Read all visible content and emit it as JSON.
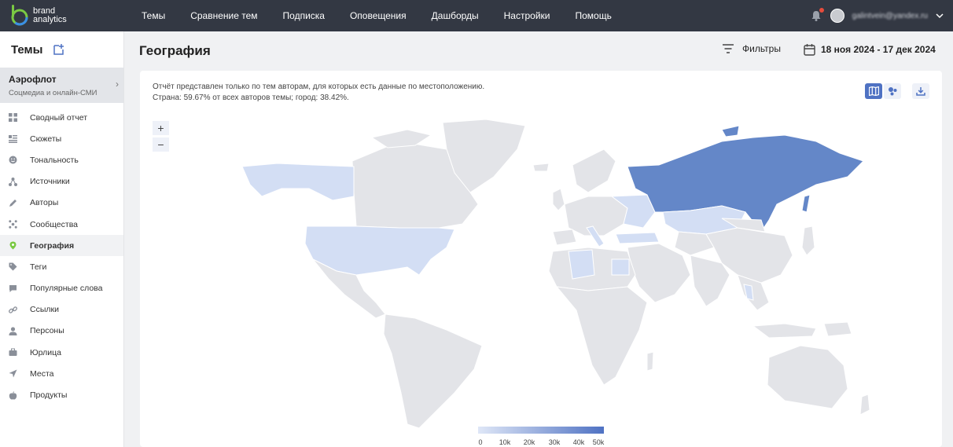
{
  "brand": {
    "line1": "brand",
    "line2": "analytics"
  },
  "nav": {
    "items": [
      "Темы",
      "Сравнение тем",
      "Подписка",
      "Оповещения",
      "Дашборды",
      "Настройки",
      "Помощь"
    ],
    "user_email": "galintvein@yandex.ru"
  },
  "sidebar": {
    "title": "Темы",
    "topic": {
      "name": "Аэрофлот",
      "subtitle": "Соцмедиа и онлайн-СМИ"
    },
    "items": [
      {
        "label": "Сводный отчет",
        "icon": "grid-icon"
      },
      {
        "label": "Сюжеты",
        "icon": "list-icon"
      },
      {
        "label": "Тональность",
        "icon": "smile-icon"
      },
      {
        "label": "Источники",
        "icon": "nodes-icon"
      },
      {
        "label": "Авторы",
        "icon": "pen-icon"
      },
      {
        "label": "Сообщества",
        "icon": "community-icon"
      },
      {
        "label": "География",
        "icon": "location-pin-icon",
        "active": true
      },
      {
        "label": "Теги",
        "icon": "tag-icon"
      },
      {
        "label": "Популярные слова",
        "icon": "chat-icon"
      },
      {
        "label": "Ссылки",
        "icon": "link-icon"
      },
      {
        "label": "Персоны",
        "icon": "person-icon"
      },
      {
        "label": "Юрлица",
        "icon": "briefcase-icon"
      },
      {
        "label": "Места",
        "icon": "navigation-icon"
      },
      {
        "label": "Продукты",
        "icon": "apple-icon"
      }
    ]
  },
  "header": {
    "title": "География",
    "filters_label": "Фильтры",
    "date_range": "18 ноя 2024 - 17 дек 2024"
  },
  "card": {
    "note_line1": "Отчёт представлен только по тем авторам, для которых есть данные по местоположению.",
    "note_line2": "Страна: 59.67% от всех авторов темы; город: 38.42%."
  },
  "zoom": {
    "in": "+",
    "out": "−"
  },
  "legend": {
    "ticks": [
      "0",
      "10k",
      "20k",
      "30k",
      "40k",
      "50k"
    ],
    "color_low": "#dfe7f7",
    "color_high": "#4f72c3"
  },
  "colors": {
    "accent": "#4f72c3",
    "topbar": "#333843",
    "land": "#e3e4e8",
    "russia": "#6487c8",
    "light_fill": "#d3def4"
  }
}
